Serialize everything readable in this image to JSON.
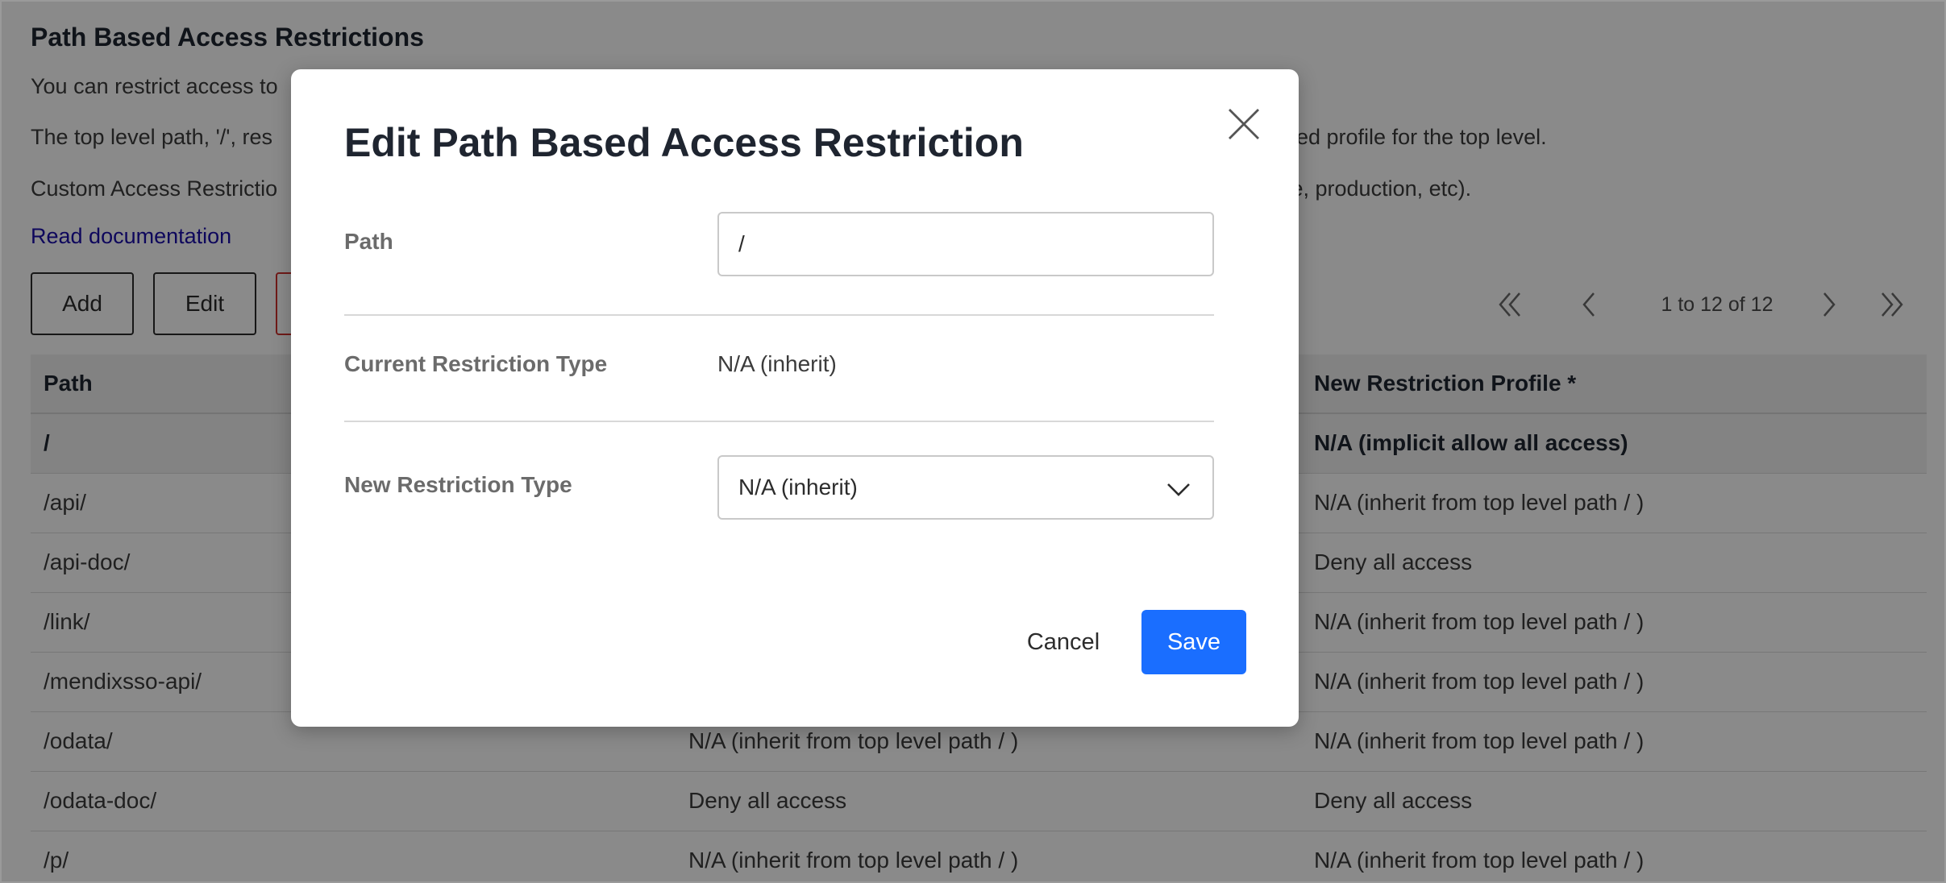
{
  "page": {
    "title": "Path Based Access Restrictions",
    "description_line1": "You can restrict access to",
    "description_line2_start": "The top level path, '/', res",
    "description_line2_end": "ed profile for the top level.",
    "description_line3_start": "Custom Access Restrictio",
    "description_line3_end": "ce, production, etc).",
    "doc_link": "Read documentation"
  },
  "toolbar": {
    "add_label": "Add",
    "edit_label": "Edit",
    "delete_label": ""
  },
  "pagination": {
    "info": "1 to 12 of 12"
  },
  "table": {
    "headers": [
      "Path",
      "",
      "New Restriction Profile *"
    ],
    "rows": [
      {
        "path": "/",
        "current": "",
        "new": "N/A (implicit allow all access)",
        "selected": true
      },
      {
        "path": "/api/",
        "current": "",
        "new": "N/A (inherit from top level path / )"
      },
      {
        "path": "/api-doc/",
        "current": "",
        "new": "Deny all access"
      },
      {
        "path": "/link/",
        "current": "",
        "new": "N/A (inherit from top level path / )"
      },
      {
        "path": "/mendixsso-api/",
        "current": "",
        "new": "N/A (inherit from top level path / )"
      },
      {
        "path": "/odata/",
        "current": "N/A (inherit from top level path / )",
        "new": "N/A (inherit from top level path / )"
      },
      {
        "path": "/odata-doc/",
        "current": "Deny all access",
        "new": "Deny all access"
      },
      {
        "path": "/p/",
        "current": "N/A (inherit from top level path / )",
        "new": "N/A (inherit from top level path / )"
      }
    ]
  },
  "modal": {
    "title": "Edit Path Based Access Restriction",
    "path_label": "Path",
    "path_value": "/",
    "current_type_label": "Current Restriction Type",
    "current_type_value": "N/A (inherit)",
    "new_type_label": "New Restriction Type",
    "new_type_value": "N/A (inherit)",
    "cancel_label": "Cancel",
    "save_label": "Save"
  },
  "colors": {
    "primary": "#1a6eff",
    "link": "#1a0dab",
    "danger": "#d0312d",
    "overlay": "rgba(0,0,0,0.46)"
  },
  "icons": {
    "close": "close-icon",
    "dropdown": "chevron-down-icon",
    "first": "double-chevron-left-icon",
    "prev": "chevron-left-icon",
    "next": "chevron-right-icon",
    "last": "double-chevron-right-icon"
  }
}
